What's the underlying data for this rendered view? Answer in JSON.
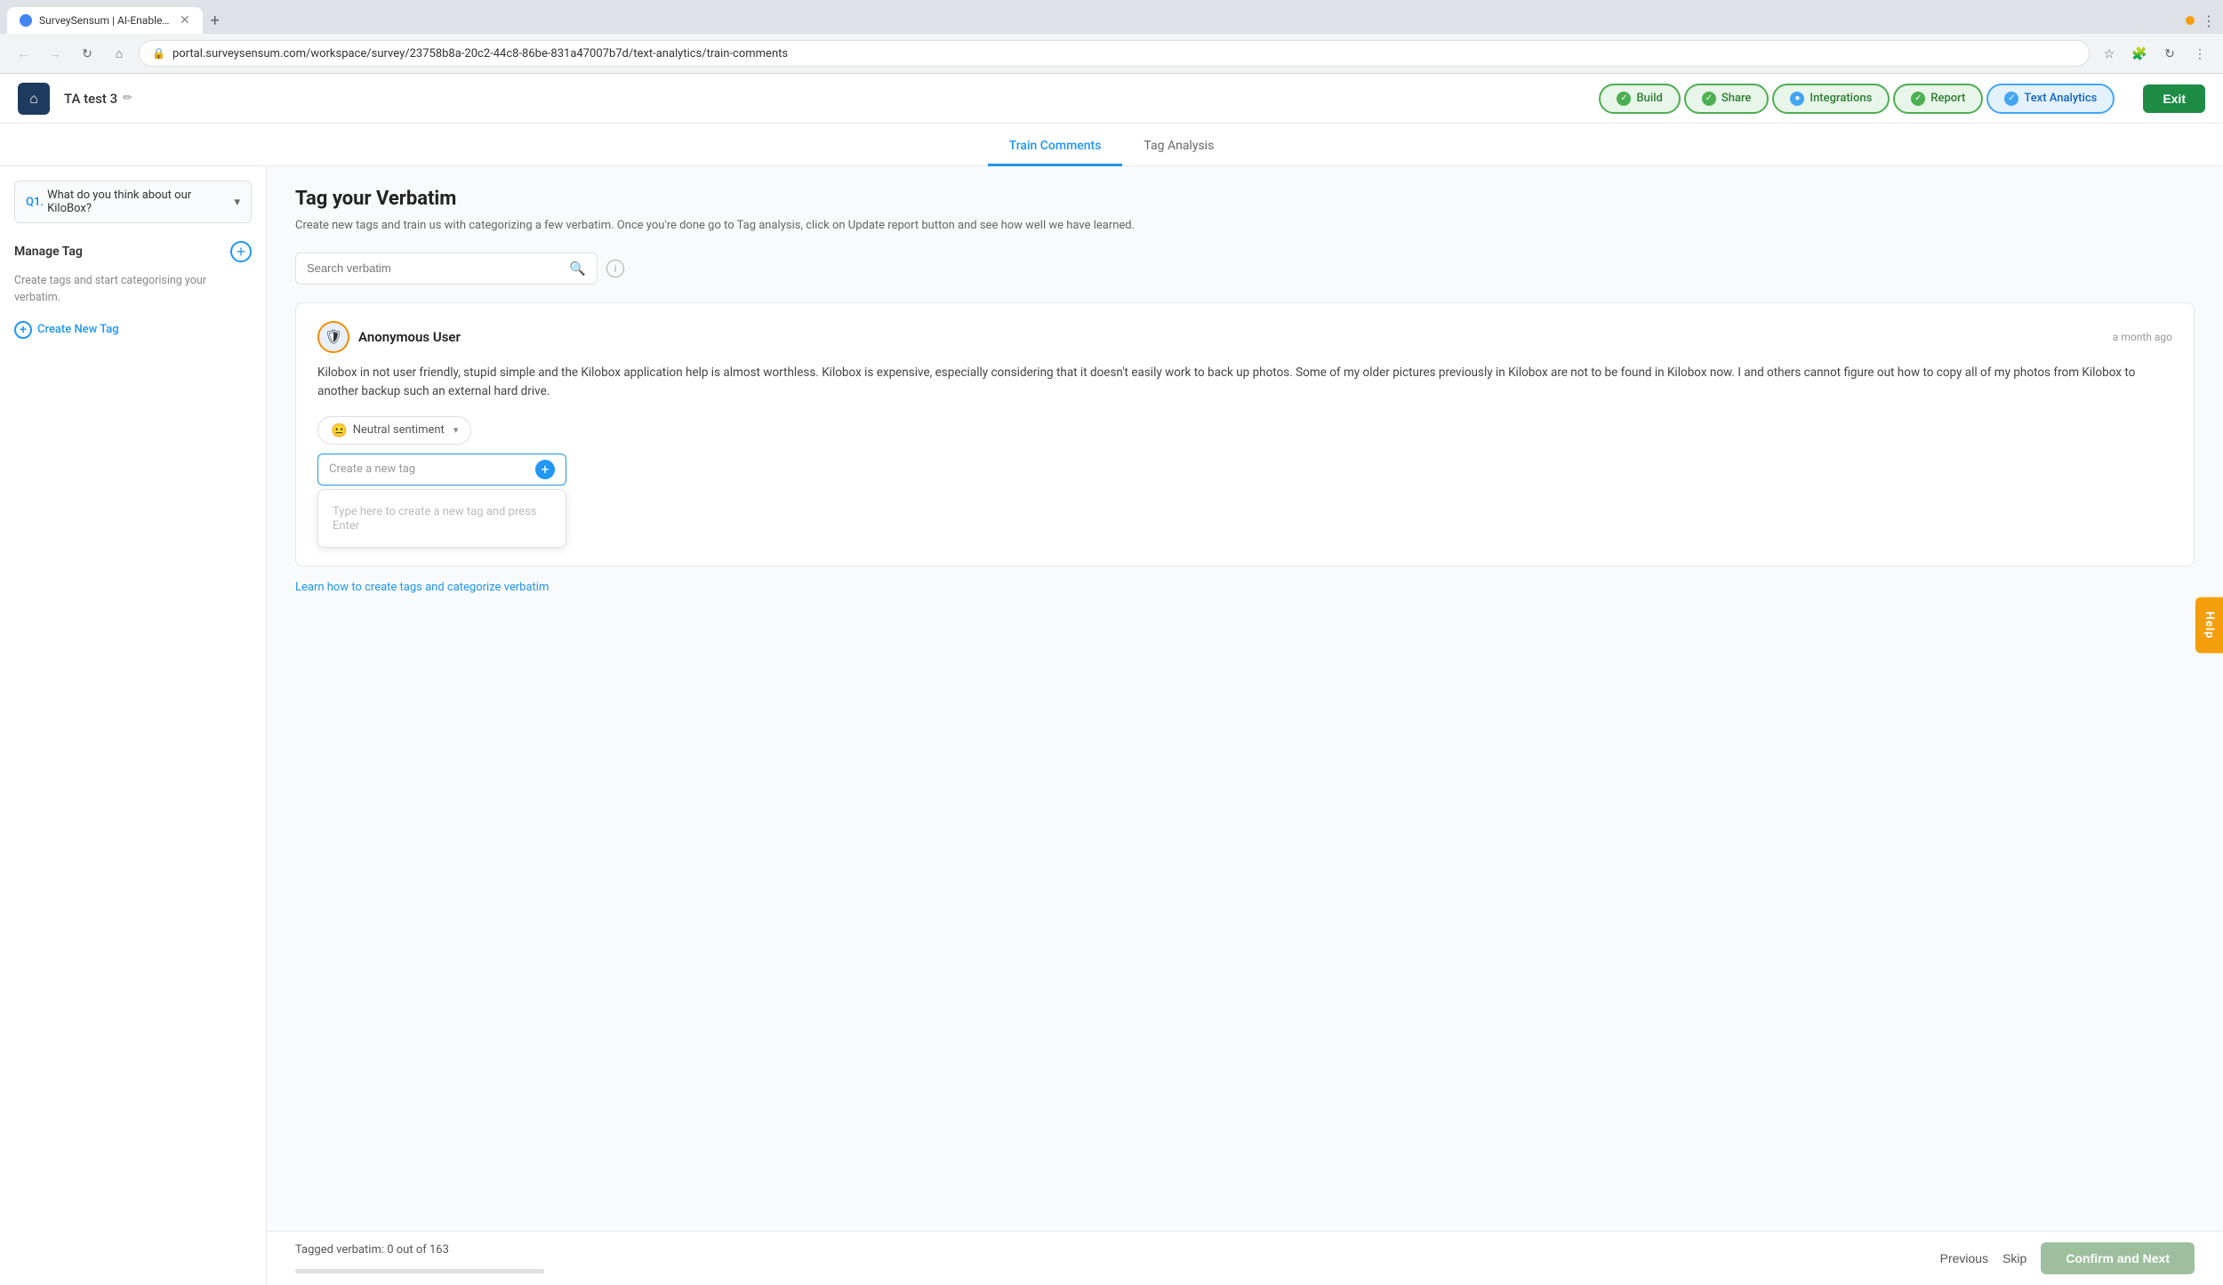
{
  "browser": {
    "tab_title": "SurveySensum | AI-Enabled E...",
    "url": "portal.surveysensum.com/workspace/survey/23758b8a-20c2-44c8-86be-831a47007b7d/text-analytics/train-comments",
    "new_tab_icon": "+",
    "menu_icon": "⋮"
  },
  "header": {
    "home_icon": "⌂",
    "project_name": "TA test 3",
    "edit_icon": "✏",
    "nav_tabs": [
      {
        "label": "Build",
        "state": "active"
      },
      {
        "label": "Share",
        "state": "active"
      },
      {
        "label": "Integrations",
        "state": "loading"
      },
      {
        "label": "Report",
        "state": "active"
      },
      {
        "label": "Text Analytics",
        "state": "text-analytics"
      }
    ],
    "exit_label": "Exit"
  },
  "sub_tabs": [
    {
      "label": "Train Comments",
      "active": true
    },
    {
      "label": "Tag Analysis",
      "active": false
    }
  ],
  "sidebar": {
    "question_label": "Q1.",
    "question_text": "What do you think about our KiloBox?",
    "manage_tag_title": "Manage Tag",
    "description": "Create tags and start categorising your verbatim.",
    "create_new_tag_label": "Create New Tag"
  },
  "main": {
    "title": "Tag your Verbatim",
    "description": "Create new tags and train us with categorizing a few verbatim. Once you're done go to Tag analysis, click on Update report button and see how well we have learned.",
    "search_placeholder": "Search verbatim",
    "verbatim": {
      "user_name": "Anonymous User",
      "time_ago": "a month ago",
      "user_icon": "🛡",
      "text": "Kilobox in not user friendly, stupid simple and the Kilobox application help is almost worthless. Kilobox is expensive, especially considering that it doesn't easily work to back up photos. Some of my older pictures previously in Kilobox are not to be found in Kilobox now. I and others cannot figure out how to copy all of my photos from Kilobox to another backup such an external hard drive.",
      "sentiment_label": "Neutral sentiment",
      "create_tag_placeholder": "Create a new tag",
      "tag_input_hint": "Type here to create a new tag and press Enter"
    },
    "learn_link": "Learn how to create tags and categorize verbatim",
    "tagged_verbatim": "Tagged verbatim: 0 out of 163",
    "progress_percent": 0,
    "prev_label": "Previous",
    "skip_label": "Skip",
    "confirm_next_label": "Confirm and Next"
  },
  "help": {
    "label": "Help"
  }
}
